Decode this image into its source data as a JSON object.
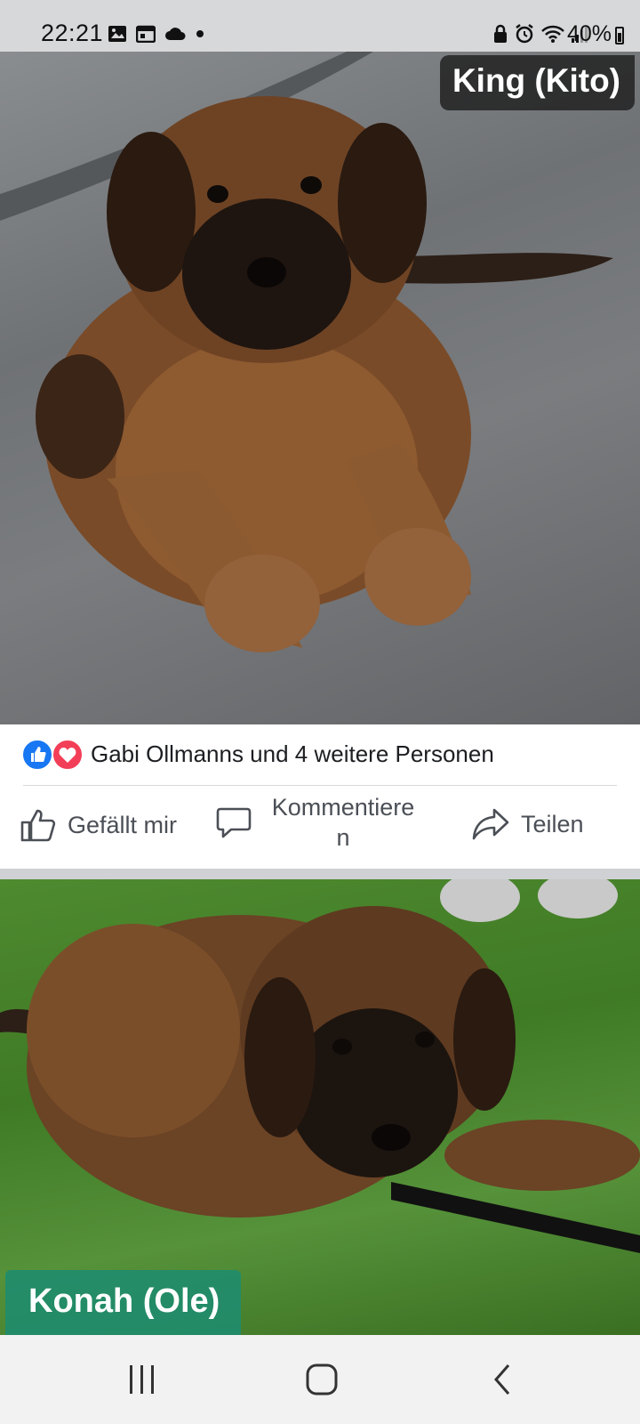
{
  "status_bar": {
    "time": "22:21",
    "battery": "40%",
    "left_icons": [
      "image-icon",
      "calendar-icon",
      "cloud-icon",
      "dot-icon"
    ],
    "right_icons": [
      "lock-icon",
      "alarm-icon",
      "wifi-icon",
      "signal-icon",
      "battery-icon"
    ]
  },
  "post1": {
    "photo_icon": "dog-photo",
    "name_tag": "King (Kito)"
  },
  "reactions": {
    "icons": [
      "like-reaction-icon",
      "love-reaction-icon"
    ],
    "text": "Gabi Ollmanns und 4 weitere Personen"
  },
  "actions": {
    "like_label": "Gefällt mir",
    "comment_label": "Kommentiere\nn",
    "share_label": "Teilen"
  },
  "post2": {
    "photo_icon": "dog-photo",
    "name_tag": "Konah (Ole)"
  },
  "navbar": {
    "items": [
      "recent-apps-icon",
      "home-icon",
      "back-icon"
    ]
  },
  "colors": {
    "like_blue": "#1877f2",
    "love_red": "#f33e58",
    "king_tag_bg": "#1e1e1e",
    "konah_tag_bg": "#1e8c6e"
  }
}
